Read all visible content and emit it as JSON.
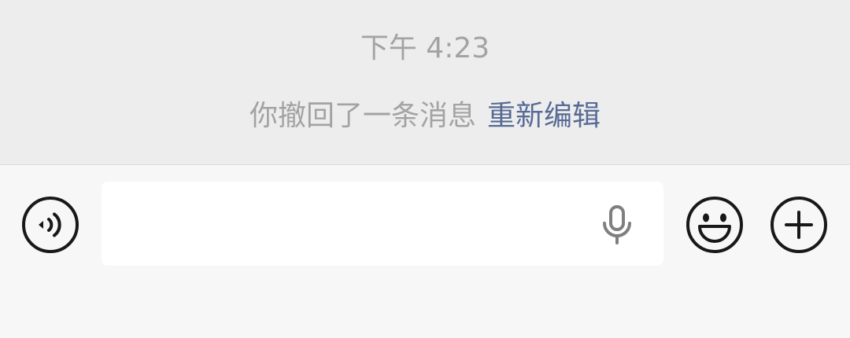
{
  "chat": {
    "timestamp": "下午 4:23",
    "system_message": {
      "text": "你撤回了一条消息",
      "action_label": "重新编辑"
    }
  },
  "input_bar": {
    "text_value": "",
    "icons": {
      "left": "voice-icon",
      "inside_right": "microphone-icon",
      "right_1": "emoji-icon",
      "right_2": "plus-icon"
    }
  },
  "colors": {
    "chat_background": "#EDEDED",
    "input_bar_background": "#F7F7F7",
    "system_text": "#A3A3A3",
    "link": "#576B95",
    "icon": "#181818"
  }
}
